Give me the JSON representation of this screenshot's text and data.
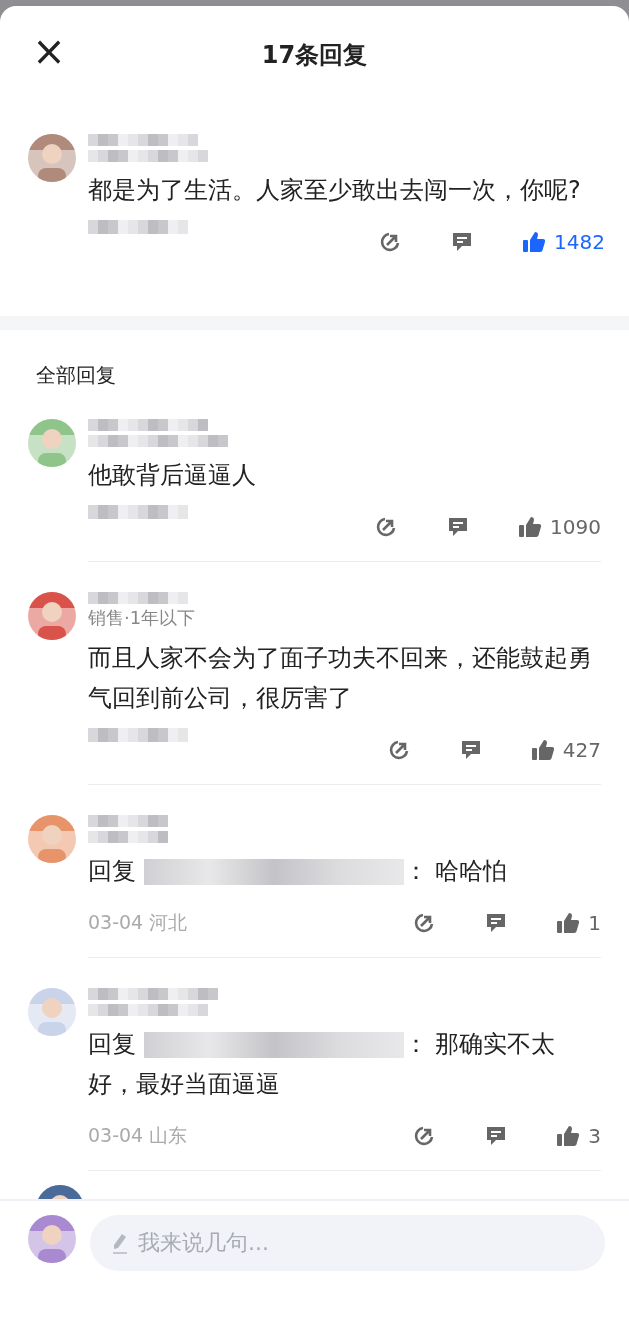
{
  "header": {
    "close": "×",
    "title": "17条回复"
  },
  "main_comment": {
    "content": "都是为了生活。人家至少敢出去闯一次，你呢?",
    "likes": "1482",
    "liked": true
  },
  "section_title": "全部回复",
  "replies": [
    {
      "content": "他敢背后逼逼人",
      "likes": "1090",
      "liked": false
    },
    {
      "subtitle": "销售·1年以下",
      "content": "而且人家不会为了面子功夫不回来，还能鼓起勇气回到前公司，很厉害了",
      "likes": "427",
      "liked": false
    },
    {
      "reply_prefix": "回复",
      "reply_suffix": "：",
      "content": "哈哈怕",
      "date": "03-04",
      "location": "河北",
      "likes": "1",
      "liked": false
    },
    {
      "reply_prefix": "回复",
      "reply_suffix": "：",
      "content": "那确实不太好，最好当面逼逼",
      "date": "03-04",
      "location": "山东",
      "likes": "3",
      "liked": false
    }
  ],
  "composer": {
    "placeholder": "我来说几句..."
  }
}
